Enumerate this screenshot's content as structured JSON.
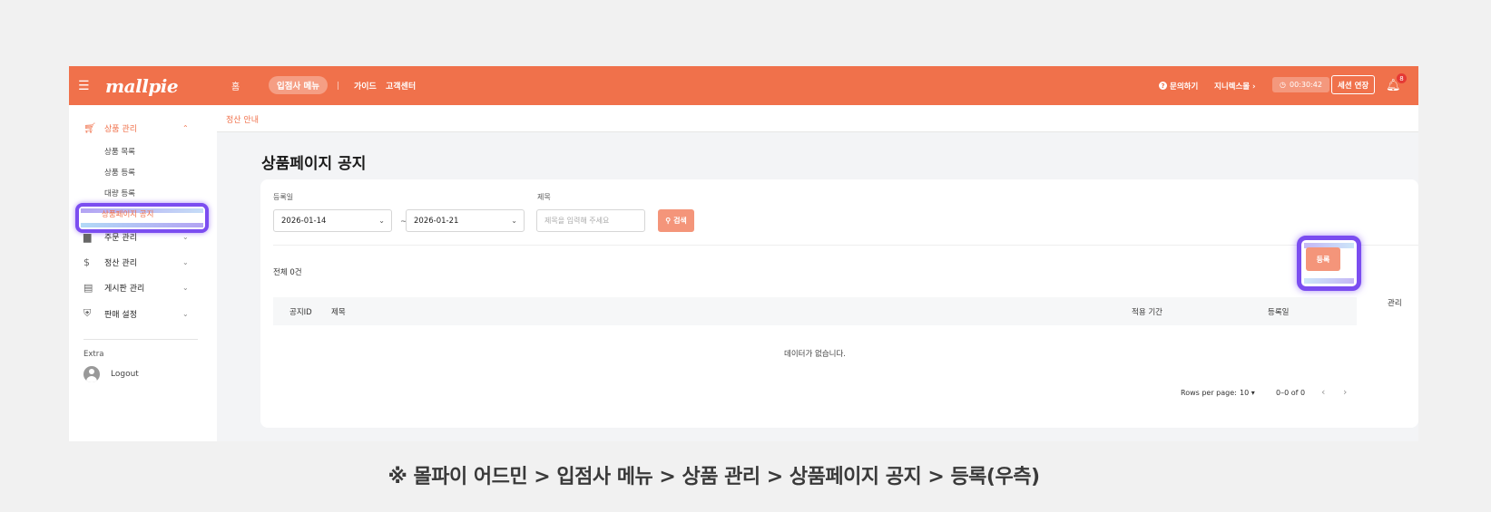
{
  "topbar": {
    "menu_icon": "hamburger-icon",
    "logo": "mallpie",
    "home": "홈",
    "partner_menu": "입점사 메뉴",
    "separator": "|",
    "guide": "가이드",
    "support": "고객센터",
    "inquiry": "문의하기",
    "user": "지니렉스몰 ›",
    "timer": "00:30:42",
    "extend": "세션 연장",
    "notifications": "8"
  },
  "sidebar": {
    "product_mgmt": "상품 관리",
    "sub": [
      "상품 목록",
      "상품 등록",
      "대량 등록",
      "상품페이지 공지"
    ],
    "order_mgmt": "주문 관리",
    "settlement_mgmt": "정산 관리",
    "board_mgmt": "게시판 관리",
    "sales_settings": "판매 설정",
    "extra": "Extra",
    "logout": "Logout"
  },
  "breadcrumb": "정산 안내",
  "page": {
    "title": "상품페이지 공지",
    "filters": {
      "date_label": "등록일",
      "date_from": "2026-01-14",
      "tilde": "~",
      "date_to": "2026-01-21",
      "title_label": "제목",
      "title_placeholder": "제목을 입력해 주세요",
      "search": "검색"
    },
    "total": "전체 0건",
    "register": "등록",
    "columns": [
      "공지ID",
      "제목",
      "적용 기간",
      "등록일",
      "관리"
    ],
    "empty": "데이터가 없습니다.",
    "pager": {
      "rows_label": "Rows per page:",
      "rows_value": "10",
      "range": "0–0 of 0"
    }
  },
  "caption": "※ 몰파이 어드민 > 입점사 메뉴 > 상품 관리 > 상품페이지 공지 > 등록(우측)",
  "colors": {
    "brand": "#f0714b",
    "button": "#f4957a",
    "highlight": "#7b4df0"
  }
}
